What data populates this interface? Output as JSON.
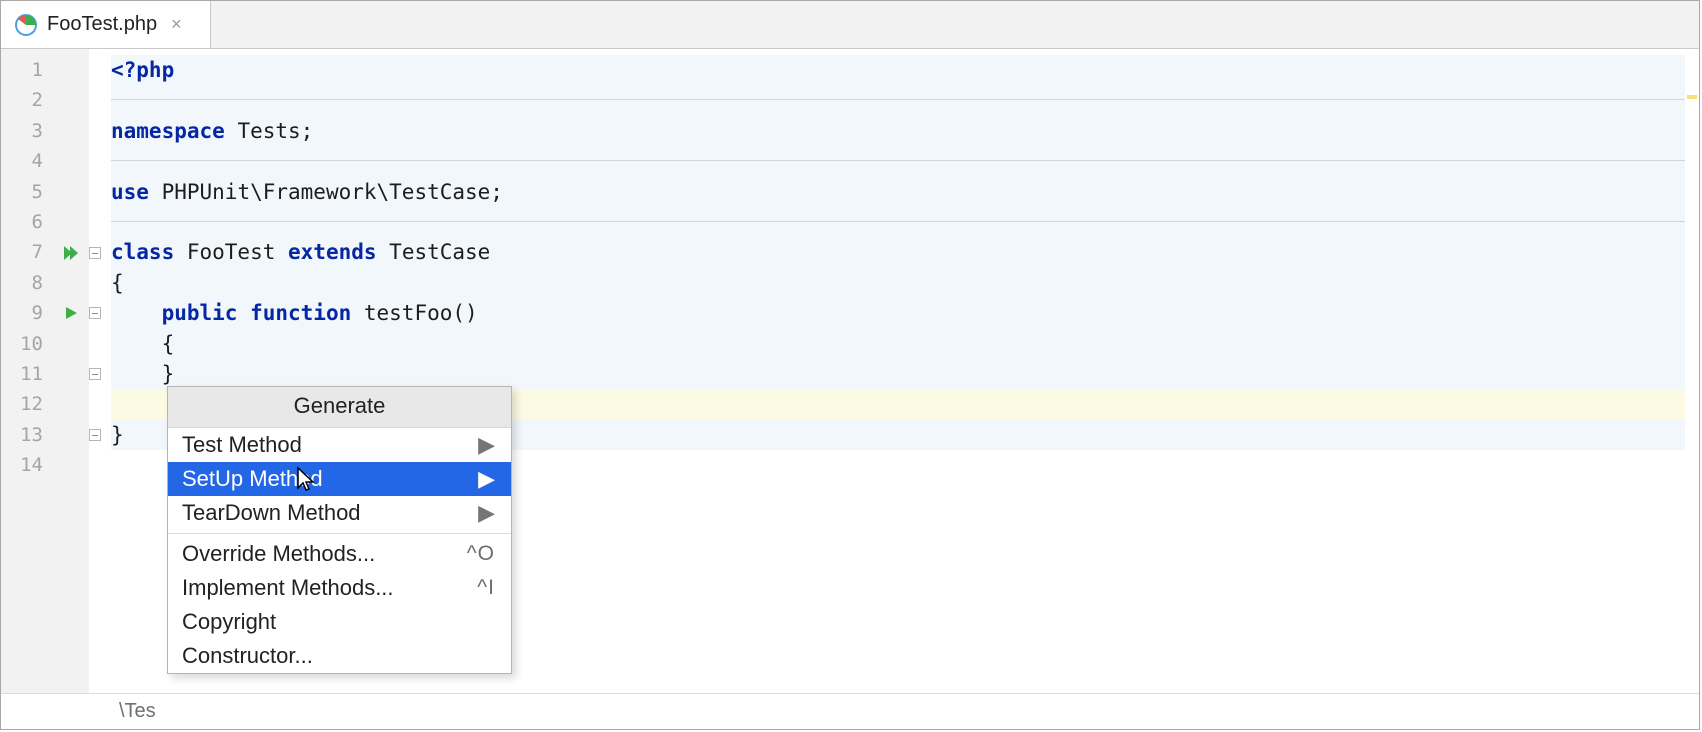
{
  "tab": {
    "filename": "FooTest.php"
  },
  "lines": [
    "1",
    "2",
    "3",
    "4",
    "5",
    "6",
    "7",
    "8",
    "9",
    "10",
    "11",
    "12",
    "13",
    "14"
  ],
  "code": {
    "l1_open": "<?php",
    "l3_ns": "namespace",
    "l3_rest": " Tests;",
    "l5_use": "use",
    "l5_rest": " PHPUnit\\Framework\\TestCase;",
    "l7_class": "class",
    "l7_name": " FooTest ",
    "l7_ext": "extends",
    "l7_tc": " TestCase",
    "l8": "{",
    "l9_pub": "public",
    "l9_fn": " function",
    "l9_name": " testFoo()",
    "l10": "    {",
    "l11": "    }",
    "l13": "}"
  },
  "breadcrumb": "\\Tes",
  "popup": {
    "title": "Generate",
    "items": [
      {
        "label": "Test Method",
        "submenu": true
      },
      {
        "label": "SetUp Method",
        "submenu": true,
        "selected": true
      },
      {
        "label": "TearDown Method",
        "submenu": true
      }
    ],
    "items2": [
      {
        "label": "Override Methods...",
        "shortcut": "^O"
      },
      {
        "label": "Implement Methods...",
        "shortcut": "^I"
      },
      {
        "label": "Copyright"
      },
      {
        "label": "Constructor..."
      }
    ]
  }
}
